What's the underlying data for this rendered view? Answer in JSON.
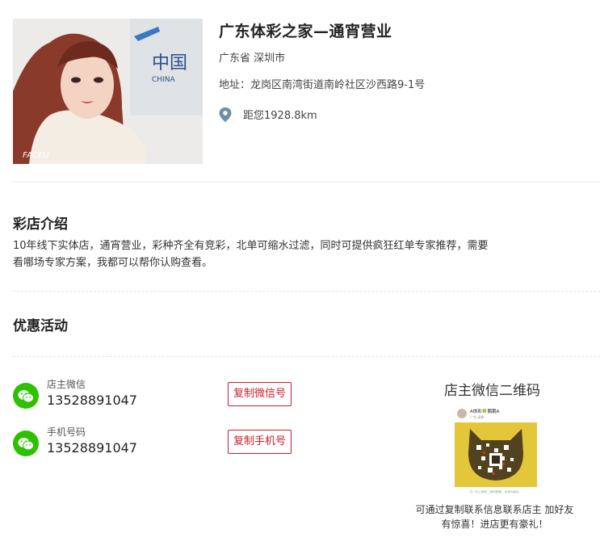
{
  "store": {
    "name": "广东体彩之家—通宵营业",
    "region": "广东省 深圳市",
    "address": "地址：龙岗区南湾街道南岭社区沙西路9-1号",
    "distance": "距您1928.8km",
    "photo_watermark": "FACEU",
    "photo_wall_text": "中国",
    "photo_wall_text_2": "CHINA"
  },
  "intro": {
    "title": "彩店介绍",
    "text": "10年线下实体店，通宵营业，彩种齐全有竞彩，北单可缩水过滤，同时可提供疯狂红单专家推荐，需要看哪场专家方案，我都可以帮你认购查看。"
  },
  "promo": {
    "title": "优惠活动"
  },
  "contacts": [
    {
      "label": "店主微信",
      "value": "13528891047",
      "button": "复制微信号",
      "icon": "wechat-icon"
    },
    {
      "label": "手机号码",
      "value": "13528891047",
      "button": "复制手机号",
      "icon": "wechat-icon"
    }
  ],
  "qr": {
    "title": "店主微信二维码",
    "card_header": "A体彩🍀鹏鹏A",
    "card_sub": "广东 深圳",
    "card_footer": "扫一扫上面的二维码图案，加我为朋友。",
    "note": "可通过复制联系信息联系店主 加好友有惊喜！进店更有豪礼！"
  },
  "colors": {
    "accent_red": "#c8202a",
    "wechat_green": "#2dc100",
    "pin_blue": "#6a8fa8",
    "qr_yellow": "#e3c63a"
  }
}
